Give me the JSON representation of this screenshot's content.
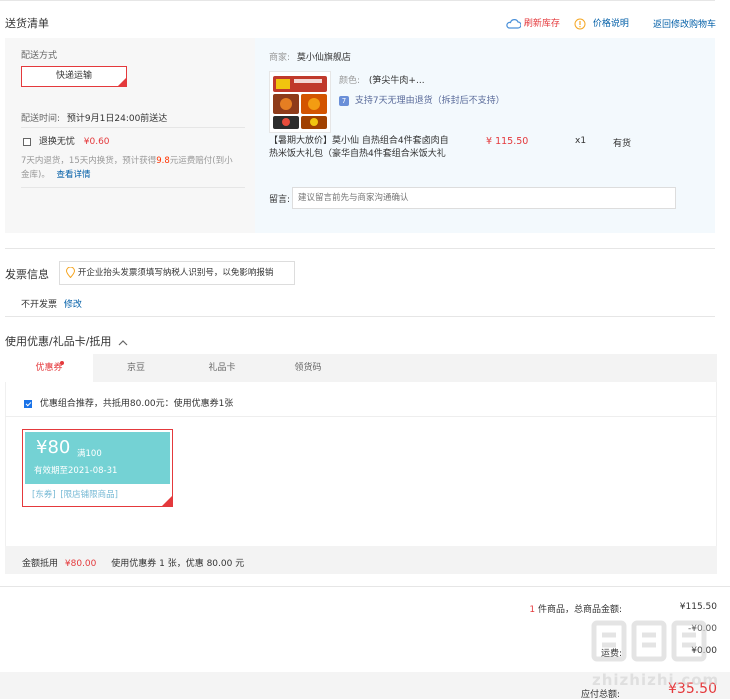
{
  "section_delivery": {
    "title": "送货清单",
    "refresh_stock": "刷新库存",
    "price_note": "价格说明",
    "back_cart": "返回修改购物车"
  },
  "shipping": {
    "method_label": "配送方式",
    "method_value": "快递运输",
    "time_label": "配送时间:",
    "time_value": "预计9月1日24:00前送达",
    "worry_free_label": "退换无忧",
    "worry_free_price": "¥0.60",
    "worry_free_desc_a": "7天内退货，15天内换货，预计获得",
    "worry_free_desc_amount": "9.8",
    "worry_free_desc_b": "元运费赔付(到小",
    "worry_free_desc_c": "金库)。",
    "worry_free_link": "查看详情"
  },
  "merchant": {
    "label": "商家:",
    "name": "莫小仙旗舰店"
  },
  "product": {
    "color_label": "颜色:",
    "color_value": "(笋尖牛肉+...",
    "return_policy": "支持7天无理由退货（拆封后不支持）",
    "title_line1": "【暑期大放价】莫小仙 自热组合4件套卤肉自",
    "title_line2": "热米饭大礼包（豪华自热4件套组合米饭大礼",
    "price": "¥ 115.50",
    "qty": "x1",
    "stock": "有货"
  },
  "remark": {
    "label": "留言:",
    "placeholder": "建议留言前先与商家沟通确认"
  },
  "invoice": {
    "title": "发票信息",
    "tip": "开企业抬头发票须填写纳税人识别号，以免影响报销",
    "status": "不开发票",
    "modify": "修改"
  },
  "coupons": {
    "title": "使用优惠/礼品卡/抵用",
    "tabs": [
      "优惠券",
      "京豆",
      "礼品卡",
      "领货码"
    ],
    "recommend": "优惠组合推荐，共抵用80.00元：使用优惠券1张",
    "card_amount": "¥80",
    "card_threshold": "满100",
    "card_validity": "有效期至2021-08-31",
    "card_tag1": "[东券]",
    "card_tag2": "[限店铺限商品]",
    "summary_label": "金额抵用",
    "summary_amount": "¥80.00",
    "summary_desc": "使用优惠券 1 张，优惠 80.00 元"
  },
  "totals": {
    "count_num": "1",
    "count_text": " 件商品，总商品金额:",
    "goods_amount": "¥115.50",
    "line2_label": "",
    "line2_value": "-¥0.00",
    "freight_label": "运费:",
    "freight_value": "¥0.00",
    "payable_label": "应付总额:",
    "payable_value": "¥35.50"
  },
  "watermark": {
    "logo": "值|值|值",
    "url": "zhizhizhi.com"
  },
  "colors": {
    "accent_red": "#e4393c",
    "link_blue": "#005ea7",
    "coupon_teal": "#74d2d4",
    "panel_gray": "#f7f7f7",
    "panel_blue": "#f3f9fd"
  }
}
